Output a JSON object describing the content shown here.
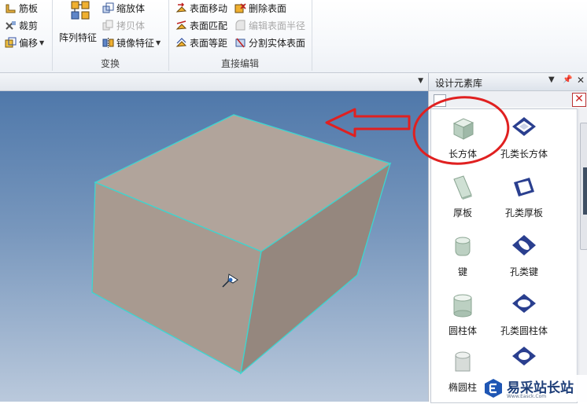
{
  "ribbon": {
    "col1": [
      {
        "label": "筋板",
        "icon": "rib-icon"
      },
      {
        "label": "裁剪",
        "icon": "trim-icon"
      },
      {
        "label": "偏移",
        "icon": "offset-icon",
        "has_dropdown": true
      }
    ],
    "array_feature": {
      "label": "阵列特征",
      "icon": "array-feature-icon"
    },
    "col2": [
      {
        "label": "缩放体",
        "icon": "scale-body-icon",
        "disabled": false
      },
      {
        "label": "拷贝体",
        "icon": "copy-body-icon",
        "disabled": true
      },
      {
        "label": "镜像特征",
        "icon": "mirror-feature-icon",
        "disabled": false,
        "has_dropdown": true
      }
    ],
    "col3": [
      {
        "label": "表面移动",
        "icon": "face-move-icon",
        "disabled": false
      },
      {
        "label": "表面匹配",
        "icon": "face-match-icon",
        "disabled": false
      },
      {
        "label": "表面等距",
        "icon": "face-offset-icon",
        "disabled": false
      }
    ],
    "col4": [
      {
        "label": "删除表面",
        "icon": "delete-face-icon",
        "disabled": false
      },
      {
        "label": "编辑表面半径",
        "icon": "edit-face-radius-icon",
        "disabled": true
      },
      {
        "label": "分割实体表面",
        "icon": "split-face-icon",
        "disabled": false
      }
    ],
    "groups": {
      "transform": "变换",
      "direct_edit": "直接编辑"
    }
  },
  "panel": {
    "title": "设计元素库",
    "items": [
      {
        "label": "长方体",
        "icon": "box-icon",
        "highlighted": true
      },
      {
        "label": "孔类长方体",
        "icon": "hole-box-icon"
      },
      {
        "label": "厚板",
        "icon": "thick-plate-icon"
      },
      {
        "label": "孔类厚板",
        "icon": "hole-plate-icon"
      },
      {
        "label": "键",
        "icon": "key-icon"
      },
      {
        "label": "孔类键",
        "icon": "hole-key-icon"
      },
      {
        "label": "圆柱体",
        "icon": "cylinder-icon"
      },
      {
        "label": "孔类圆柱体",
        "icon": "hole-cylinder-icon"
      },
      {
        "label": "椭圆柱",
        "icon": "elliptic-cylinder-icon"
      },
      {
        "label": "",
        "icon": "hole-elliptic-cylinder-icon"
      }
    ]
  },
  "watermark": {
    "text": "易采站长站",
    "sub": "Www.Easck.Com"
  },
  "colors": {
    "annotation_red": "#e02020",
    "box_face": "#a8998f",
    "box_edge": "#3cd6d0",
    "viewport_top": "#4f78aa"
  }
}
